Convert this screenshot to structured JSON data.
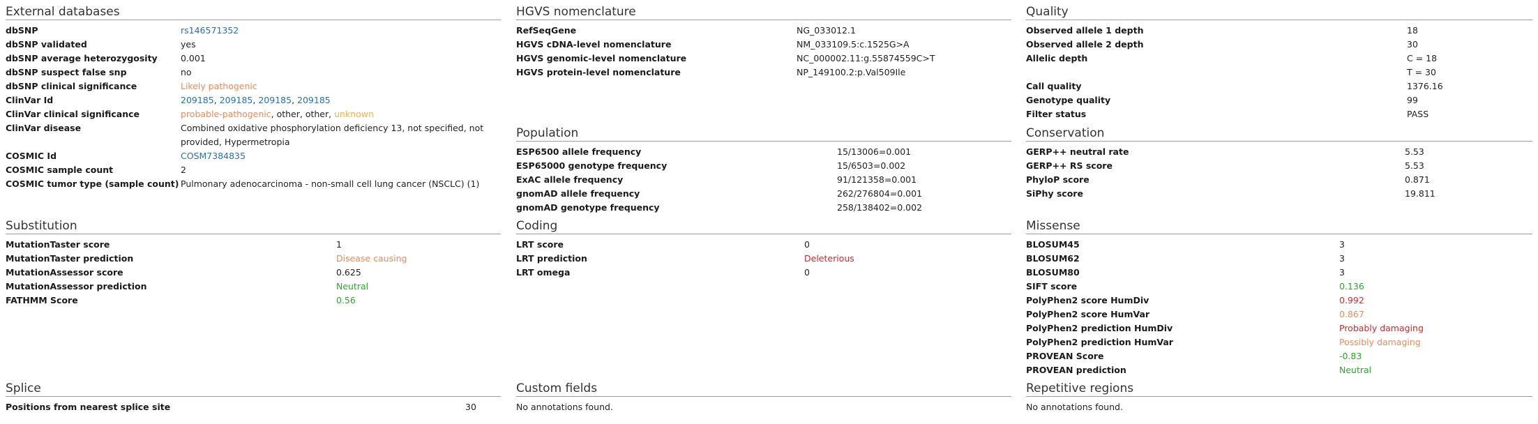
{
  "external": {
    "title": "External databases",
    "dbsnp_label": "dbSNP",
    "dbsnp_value": "rs146571352",
    "validated_label": "dbSNP validated",
    "validated_value": "yes",
    "het_label": "dbSNP average heterozygosity",
    "het_value": "0.001",
    "suspect_label": "dbSNP suspect false snp",
    "suspect_value": "no",
    "clinsig_label": "dbSNP clinical significance",
    "clinsig_value": "Likely pathogenic",
    "clinvar_id_label": "ClinVar Id",
    "clinvar_ids": [
      "209185",
      "209185",
      "209185",
      "209185"
    ],
    "clinvar_sig_label": "ClinVar clinical significance",
    "clinvar_sig": {
      "a": "probable-pathogenic",
      "b": "other",
      "c": "other",
      "d": "unknown"
    },
    "clinvar_disease_label": "ClinVar disease",
    "clinvar_disease_value": "Combined oxidative phosphorylation deficiency 13, not specified, not provided, Hypermetropia",
    "cosmic_id_label": "COSMIC Id",
    "cosmic_id_value": "COSM7384835",
    "cosmic_count_label": "COSMIC sample count",
    "cosmic_count_value": "2",
    "cosmic_tumor_label": "COSMIC tumor type (sample count)",
    "cosmic_tumor_value": "Pulmonary adenocarcinoma - non-small cell lung cancer (NSCLC) (1)"
  },
  "hgvs": {
    "title": "HGVS nomenclature",
    "rows": [
      {
        "label": "RefSeqGene",
        "value": "NG_033012.1"
      },
      {
        "label": "HGVS cDNA-level nomenclature",
        "value": "NM_033109.5:c.1525G>A"
      },
      {
        "label": "HGVS genomic-level nomenclature",
        "value": "NC_000002.11:g.55874559C>T"
      },
      {
        "label": "HGVS protein-level nomenclature",
        "value": "NP_149100.2:p.Val509Ile"
      }
    ]
  },
  "quality": {
    "title": "Quality",
    "allele1_label": "Observed allele 1 depth",
    "allele1_value": "18",
    "allele2_label": "Observed allele 2 depth",
    "allele2_value": "30",
    "allelic_label": "Allelic depth",
    "allelic_value_c": "C = 18",
    "allelic_value_t": "T = 30",
    "callq_label": "Call quality",
    "callq_value": "1376.16",
    "genoq_label": "Genotype quality",
    "genoq_value": "99",
    "filter_label": "Filter status",
    "filter_value": "PASS"
  },
  "population": {
    "title": "Population",
    "rows": [
      {
        "label": "ESP6500 allele frequency",
        "value": "15/13006=0.001"
      },
      {
        "label": "ESP65000 genotype frequency",
        "value": "15/6503=0.002"
      },
      {
        "label": "ExAC allele frequency",
        "value": "91/121358=0.001"
      },
      {
        "label": "gnomAD allele frequency",
        "value": "262/276804=0.001"
      },
      {
        "label": "gnomAD genotype frequency",
        "value": "258/138402=0.002"
      }
    ]
  },
  "conservation": {
    "title": "Conservation",
    "rows": [
      {
        "label": "GERP++ neutral rate",
        "value": "5.53"
      },
      {
        "label": "GERP++ RS score",
        "value": "5.53"
      },
      {
        "label": "PhyloP score",
        "value": "0.871"
      },
      {
        "label": "SiPhy score",
        "value": "19.811"
      }
    ]
  },
  "substitution": {
    "title": "Substitution",
    "rows": [
      {
        "label": "MutationTaster score",
        "value": "1"
      },
      {
        "label": "MutationTaster prediction",
        "value": "Disease causing"
      },
      {
        "label": "MutationAssessor score",
        "value": "0.625"
      },
      {
        "label": "MutationAssessor prediction",
        "value": "Neutral"
      },
      {
        "label": "FATHMM Score",
        "value": "0.56"
      }
    ]
  },
  "coding": {
    "title": "Coding",
    "rows": [
      {
        "label": "LRT score",
        "value": "0"
      },
      {
        "label": "LRT prediction",
        "value": "Deleterious"
      },
      {
        "label": "LRT omega",
        "value": "0"
      }
    ]
  },
  "missense": {
    "title": "Missense",
    "rows": [
      {
        "label": "BLOSUM45",
        "value": "3"
      },
      {
        "label": "BLOSUM62",
        "value": "3"
      },
      {
        "label": "BLOSUM80",
        "value": "3"
      },
      {
        "label": "SIFT score",
        "value": "0.136"
      },
      {
        "label": "PolyPhen2 score HumDiv",
        "value": "0.992"
      },
      {
        "label": "PolyPhen2 score HumVar",
        "value": "0.867"
      },
      {
        "label": "PolyPhen2 prediction HumDiv",
        "value": "Probably damaging"
      },
      {
        "label": "PolyPhen2 prediction HumVar",
        "value": "Possibly damaging"
      },
      {
        "label": "PROVEAN Score",
        "value": "-0.83"
      },
      {
        "label": "PROVEAN prediction",
        "value": "Neutral"
      }
    ]
  },
  "splice": {
    "title": "Splice",
    "rows": [
      {
        "label": "Positions from nearest splice site",
        "value": "30"
      }
    ]
  },
  "custom": {
    "title": "Custom fields",
    "note": "No annotations found."
  },
  "repetitive": {
    "title": "Repetitive regions",
    "note": "No annotations found."
  },
  "colors": {
    "link": "#2a6fb0",
    "orange": "#f08a5a",
    "yellow": "#f2b33d",
    "red": "#d8262a",
    "green": "#2aa82a",
    "rule": "#9a9a9a"
  }
}
